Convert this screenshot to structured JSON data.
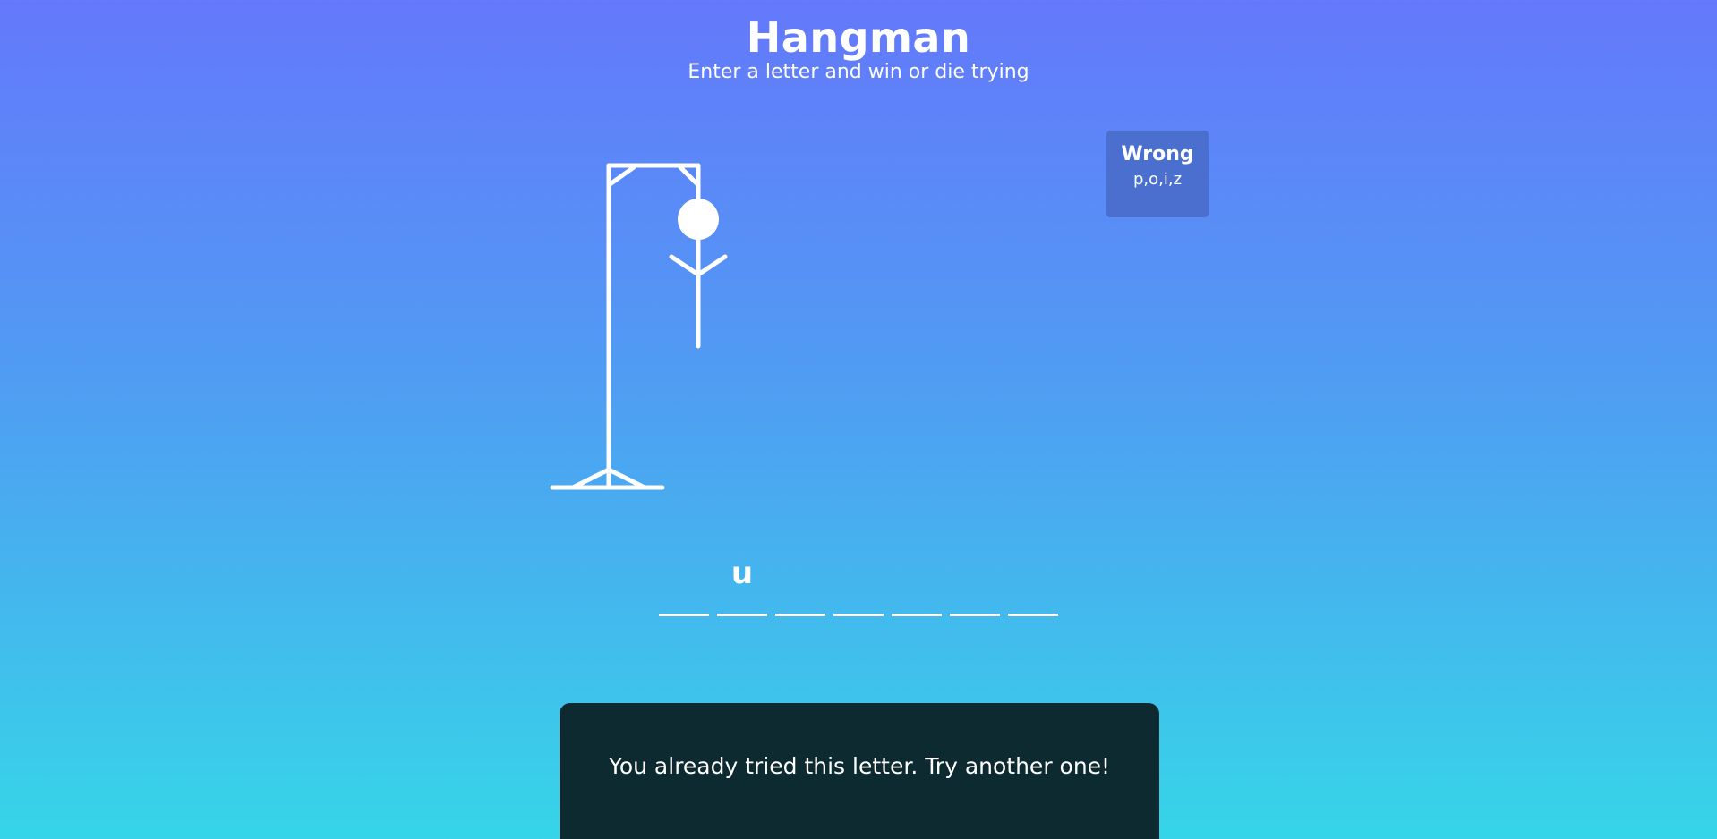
{
  "header": {
    "title": "Hangman",
    "subtitle": "Enter a letter and win or die trying"
  },
  "wrong_letters": {
    "title": "Wrong",
    "letters": "p,o,i,z"
  },
  "word": {
    "slots": [
      "",
      "u",
      "",
      "",
      "",
      "",
      ""
    ]
  },
  "notification": {
    "message": "You already tried this letter. Try another one!"
  },
  "figure": {
    "parts_shown": [
      "head",
      "body",
      "left-arm",
      "right-arm"
    ],
    "color": "#ffffff"
  },
  "colors": {
    "background_top": "#6478fb",
    "background_bottom": "#36d5e8",
    "wrong_box": "#4a6fcf",
    "notification_bg": "#0d2a30"
  }
}
